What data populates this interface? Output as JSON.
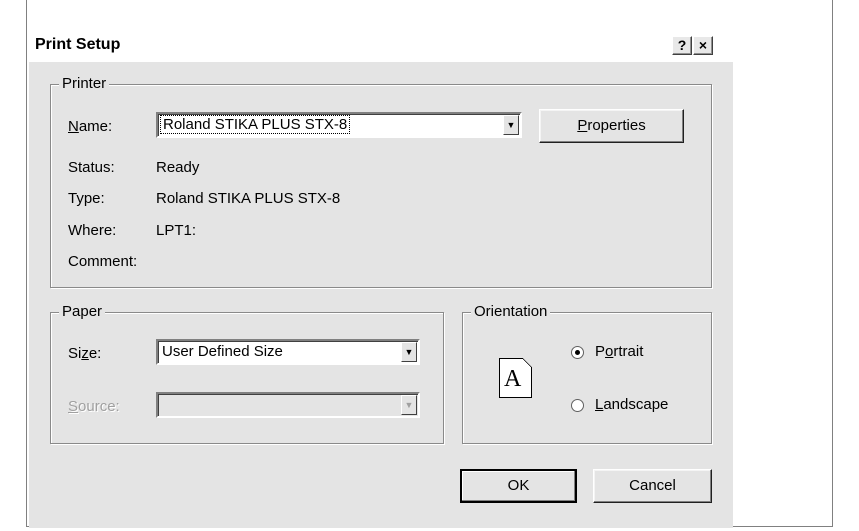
{
  "dialog": {
    "title": "Print Setup",
    "help_btn": "?",
    "close_btn": "×"
  },
  "printer": {
    "group_label": "Printer",
    "name_label_u": "N",
    "name_label_rest": "ame:",
    "name_value": "Roland STIKA PLUS STX-8",
    "properties_u": "P",
    "properties_rest": "roperties",
    "status_label": "Status:",
    "status_value": "Ready",
    "type_label": "Type:",
    "type_value": "Roland STIKA PLUS STX-8",
    "where_label": "Where:",
    "where_value": "LPT1:",
    "comment_label": "Comment:",
    "comment_value": ""
  },
  "paper": {
    "group_label": "Paper",
    "size_label_a": "Si",
    "size_label_u": "z",
    "size_label_b": "e:",
    "size_value": "User Defined Size",
    "source_label_u": "S",
    "source_label_rest": "ource:",
    "source_value": ""
  },
  "orientation": {
    "group_label": "Orientation",
    "icon_letter": "A",
    "portrait_a": "P",
    "portrait_u": "o",
    "portrait_b": "rtrait",
    "landscape_u": "L",
    "landscape_rest": "andscape",
    "selected": "portrait"
  },
  "buttons": {
    "ok": "OK",
    "cancel": "Cancel"
  },
  "icons": {
    "dropdown": "▼"
  }
}
